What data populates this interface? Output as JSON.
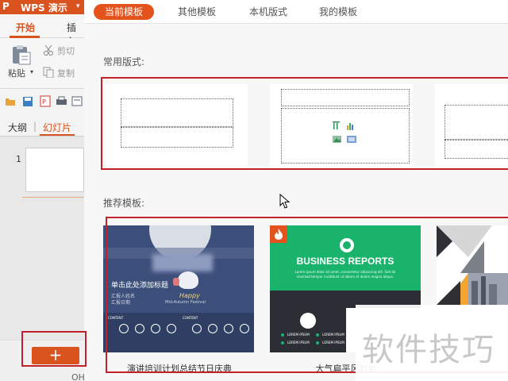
{
  "app": {
    "logo": "P",
    "title": "WPS 演示",
    "ribbon_tabs": [
      "开始",
      "插入"
    ],
    "clipboard": {
      "paste": "粘贴",
      "cut": "剪切",
      "copy": "复制"
    },
    "panel_tabs": [
      "大纲",
      "幻灯片"
    ],
    "slide_number": "1",
    "bottom_text": "OH"
  },
  "dialog": {
    "tabs": [
      "当前模板",
      "其他模板",
      "本机版式",
      "我的模板"
    ],
    "layouts_heading": "常用版式:",
    "templates_heading": "推荐模板:",
    "templates": [
      {
        "name": "演讲培训计划总结节日庆典",
        "title": "单击此处添加标题",
        "lines": [
          "汇报人姓名",
          "汇报日期"
        ],
        "script_title": "Happy",
        "script_sub": "Mid-Autumn Festival",
        "section_label": "CONTENT"
      },
      {
        "name": "大气扁平风时尚",
        "title": "BUSINESS REPORTS",
        "subtitle": "Lorem ipsum dolor sit amet, consectetur adipiscing elit. Sed do eiusmod tempor incididunt ut labore et dolore magna aliqua.",
        "badge_icon": "flame-icon",
        "list_label": "LOREM IPSUM"
      },
      {
        "name": ""
      }
    ]
  },
  "watermark": "软件技巧",
  "colors": {
    "accent": "#e5531d",
    "annotation": "#c4202a",
    "template1_bg": "#3c4f7a",
    "template2_green": "#19b36b"
  }
}
